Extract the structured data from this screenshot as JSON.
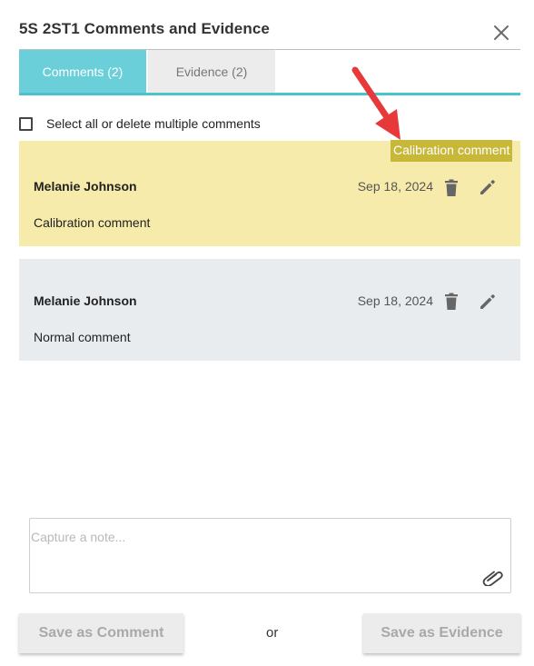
{
  "dialog": {
    "title": "5S 2ST1 Comments and Evidence"
  },
  "tabs": [
    {
      "label": "Comments (2)",
      "active": true
    },
    {
      "label": "Evidence (2)",
      "active": false
    }
  ],
  "select_all_label": "Select all or delete multiple comments",
  "calibration_badge": "Calibration comment",
  "comments": [
    {
      "author": "Melanie Johnson",
      "date": "Sep 18, 2024",
      "text": "Calibration comment",
      "type": "calibration",
      "background": "#f7ebab"
    },
    {
      "author": "Melanie Johnson",
      "date": "Sep 18, 2024",
      "text": "Normal comment",
      "type": "normal",
      "background": "#e8ecef"
    }
  ],
  "note": {
    "placeholder": "Capture a note...",
    "value": ""
  },
  "actions": {
    "save_comment_label": "Save as Comment",
    "or_label": "or",
    "save_evidence_label": "Save as Evidence"
  },
  "icons": {
    "close": "close-icon",
    "delete": "trash-icon",
    "edit": "pencil-icon",
    "attach": "paperclip-icon"
  },
  "colors": {
    "accent": "#6acfd8",
    "badge": "#c7b83a",
    "annotation_arrow": "#e8393a"
  }
}
